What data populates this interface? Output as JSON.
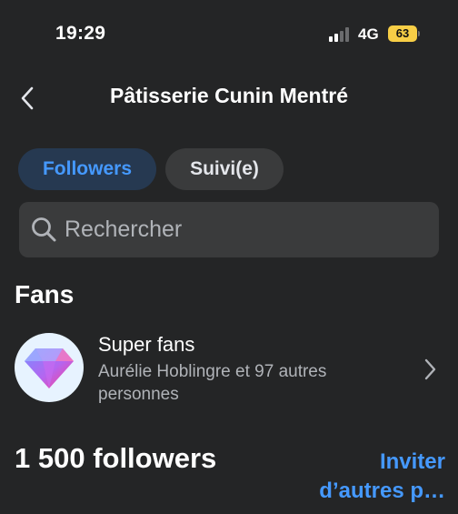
{
  "status_bar": {
    "time": "19:29",
    "network": "4G",
    "battery": "63",
    "signal_bars_active": 2,
    "signal_bars_total": 4
  },
  "header": {
    "title": "Pâtisserie Cunin Mentré",
    "back_icon": "chevron-left-icon"
  },
  "tabs": [
    {
      "label": "Followers",
      "selected": true
    },
    {
      "label": "Suivi(e)",
      "selected": false
    }
  ],
  "search": {
    "placeholder": "Rechercher",
    "value": ""
  },
  "fans": {
    "section_title": "Fans",
    "super_fans": {
      "title": "Super fans",
      "description": "Aurélie Hoblingre et 97 autres personnes",
      "icon": "diamond-icon"
    }
  },
  "followers": {
    "count_label": "1 500 followers",
    "invite_label": "Inviter d’autres p…"
  },
  "colors": {
    "background": "#242526",
    "accent": "#4599ff",
    "tab_selected_bg": "#263951",
    "chip_bg": "#3a3b3c",
    "battery": "#f7ce46"
  }
}
